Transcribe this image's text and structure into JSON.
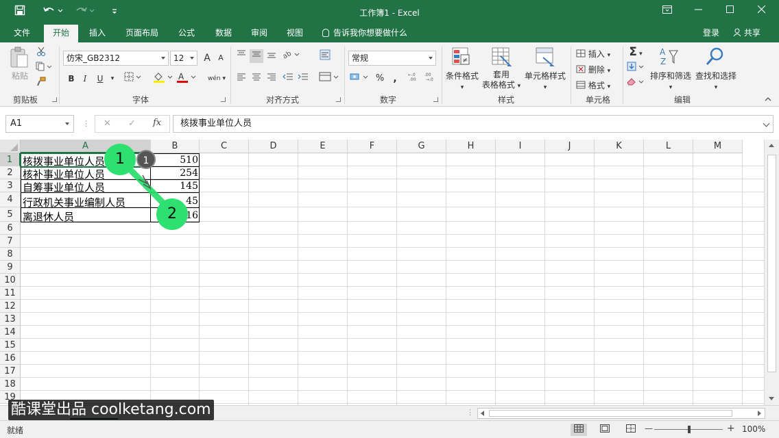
{
  "window": {
    "title": "工作簿1 - Excel",
    "min": "—",
    "max": "☐",
    "close": "✕",
    "restore": "⧉"
  },
  "qat": {
    "save_icon": "save-icon",
    "undo_icon": "undo-icon",
    "redo_icon": "redo-icon",
    "customize_icon": "customize-icon"
  },
  "tabs": [
    {
      "label": "文件"
    },
    {
      "label": "开始",
      "active": true
    },
    {
      "label": "插入"
    },
    {
      "label": "页面布局"
    },
    {
      "label": "公式"
    },
    {
      "label": "数据"
    },
    {
      "label": "审阅"
    },
    {
      "label": "视图"
    }
  ],
  "tellme": "告诉我你想要做什么",
  "account": {
    "login": "登录",
    "share": "共享"
  },
  "ribbon": {
    "clipboard": {
      "label": "剪贴板",
      "paste": "粘贴"
    },
    "font": {
      "label": "字体",
      "name": "仿宋_GB2312",
      "size": "12",
      "bold": "B",
      "italic": "I",
      "underline": "U",
      "grow": "A",
      "shrink": "A",
      "phonetic": "wén"
    },
    "alignment": {
      "label": "对齐方式"
    },
    "number": {
      "label": "数字",
      "format": "常规",
      "percent": "%",
      "comma": ","
    },
    "styles": {
      "label": "样式",
      "conditional": "条件格式",
      "table_line1": "套用",
      "table_line2": "表格格式",
      "cell_styles": "单元格样式"
    },
    "cells": {
      "label": "单元格",
      "insert": "插入",
      "delete": "删除",
      "format": "格式"
    },
    "editing": {
      "label": "编辑",
      "sort": "排序和筛选",
      "find": "查找和选择",
      "sigma": "Σ"
    }
  },
  "formula_bar": {
    "name_box": "A1",
    "cancel": "✕",
    "enter": "✓",
    "fx": "fx",
    "content": "核拨事业单位人员"
  },
  "sheet": {
    "columns": [
      "A",
      "B",
      "C",
      "D",
      "E",
      "F",
      "G",
      "H",
      "I",
      "J",
      "K",
      "L",
      "M"
    ],
    "rows": [
      "1",
      "2",
      "3",
      "4",
      "5",
      "6",
      "7",
      "8",
      "9",
      "10",
      "11",
      "12",
      "13",
      "14",
      "15",
      "16",
      "17",
      "18",
      "19"
    ],
    "data": [
      {
        "a": "核拨事业单位人员",
        "b": "510"
      },
      {
        "a": "核补事业单位人员",
        "b": "254"
      },
      {
        "a": "自筹事业单位人员",
        "b": "145"
      },
      {
        "a": "行政机关事业编制人员",
        "b": "45"
      },
      {
        "a": "离退休人员",
        "b": "16"
      }
    ]
  },
  "annotations": {
    "step1": "1",
    "step2": "2",
    "badge": "1"
  },
  "status": {
    "ready": "就绪",
    "zoom": "100%",
    "minus": "—",
    "plus": "+"
  },
  "watermark": "酷课堂出品 coolketang.com",
  "colors": {
    "accent": "#217346",
    "highlight": "#22dd66"
  }
}
